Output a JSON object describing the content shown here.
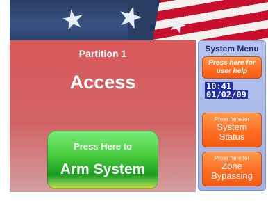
{
  "main": {
    "partition_label": "Partition 1",
    "status_text": "Access",
    "arm_button": {
      "line1": "Press Here to",
      "line2": "Arm System"
    }
  },
  "system_menu": {
    "title": "System Menu",
    "help_button": {
      "line1": "Press here for",
      "line2": "user help"
    },
    "clock": {
      "time": "10:41",
      "date": "01/02/09"
    },
    "status_button": {
      "small": "Press here for",
      "line1": "System",
      "line2": "Status"
    },
    "zone_button": {
      "small": "Press here for",
      "line1": "Zone",
      "line2": "Bypassing"
    }
  },
  "colors": {
    "main_bg": "#d9585a",
    "arm_button": "#45c93a",
    "menu_button": "#ff6a1f",
    "panel": "#b5c4ef",
    "clock_bg": "#1e2ea8"
  },
  "icons": {
    "banner_stars": "star-icon"
  }
}
